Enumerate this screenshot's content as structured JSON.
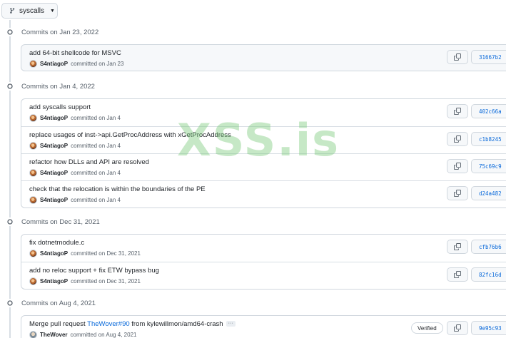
{
  "branch": {
    "name": "syscalls"
  },
  "groups": [
    {
      "heading": "Commits on Jan 23, 2022",
      "commits": [
        {
          "message": "add 64-bit shellcode for MSVC",
          "author": "S4ntiagoP",
          "committed": "committed on Jan 23",
          "sha": "31667b2"
        }
      ]
    },
    {
      "heading": "Commits on Jan 4, 2022",
      "commits": [
        {
          "message": "add syscalls support",
          "author": "S4ntiagoP",
          "committed": "committed on Jan 4",
          "sha": "402c66a"
        },
        {
          "message": "replace usages of inst->api.GetProcAddress with xGetProcAddress",
          "author": "S4ntiagoP",
          "committed": "committed on Jan 4",
          "sha": "c1b8245"
        },
        {
          "message": "refactor how DLLs and API are resolved",
          "author": "S4ntiagoP",
          "committed": "committed on Jan 4",
          "sha": "75c69c9"
        },
        {
          "message": "check that the relocation is within the boundaries of the PE",
          "author": "S4ntiagoP",
          "committed": "committed on Jan 4",
          "sha": "d24a482"
        }
      ]
    },
    {
      "heading": "Commits on Dec 31, 2021",
      "commits": [
        {
          "message": "fix dotnetmodule.c",
          "author": "S4ntiagoP",
          "committed": "committed on Dec 31, 2021",
          "sha": "cfb76b6"
        },
        {
          "message": "add no reloc support + fix ETW bypass bug",
          "author": "S4ntiagoP",
          "committed": "committed on Dec 31, 2021",
          "sha": "82fc16d"
        }
      ]
    },
    {
      "heading": "Commits on Aug 4, 2021",
      "commits": [
        {
          "message_prefix": "Merge pull request ",
          "message_link": "TheWover#90",
          "message_suffix": " from kylewillmon/amd64-crash",
          "ellipsis": "···",
          "author": "TheWover",
          "committed": "committed on Aug 4, 2021",
          "verified": "Verified",
          "sha": "9e95c93"
        }
      ]
    }
  ],
  "watermark": "XSS.is",
  "colors": {
    "link": "#0969da",
    "border": "#d0d7de",
    "muted": "#57606a",
    "watermark": "#78c878"
  }
}
